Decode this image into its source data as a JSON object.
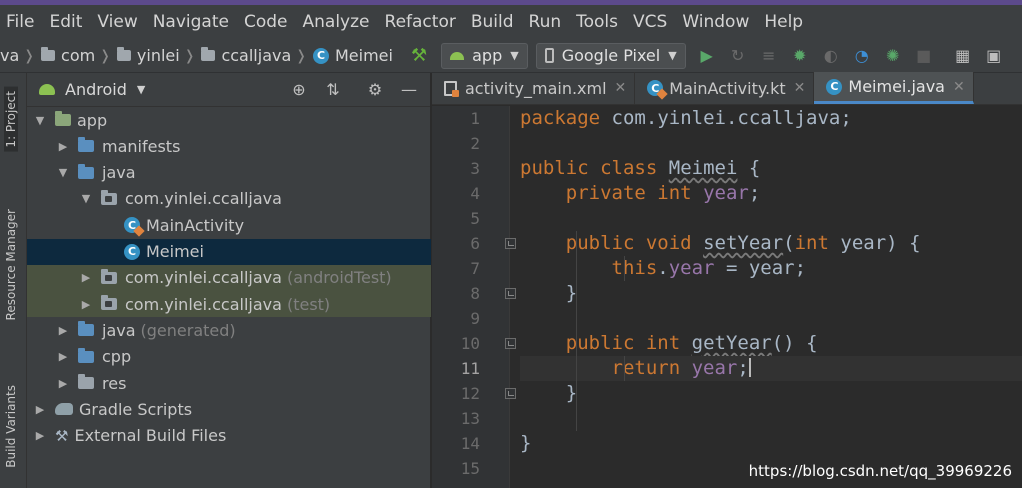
{
  "menu": [
    "File",
    "Edit",
    "View",
    "Navigate",
    "Code",
    "Analyze",
    "Refactor",
    "Build",
    "Run",
    "Tools",
    "VCS",
    "Window",
    "Help"
  ],
  "breadcrumb": {
    "items": [
      "va",
      "com",
      "yinlei",
      "ccalljava"
    ],
    "file": "Meimei"
  },
  "toolbar": {
    "config": "app",
    "device": "Google Pixel",
    "icons": [
      "build-hammer-icon",
      "run-icon",
      "apply-changes-icon",
      "apply-code-changes-icon",
      "debug-icon",
      "attach-debugger-icon",
      "profile-icon",
      "sync-icon",
      "stop-icon",
      "project-structure-icon",
      "sdk-manager-icon"
    ]
  },
  "left_strip": {
    "project": "1: Project",
    "resource_manager": "Resource Manager",
    "build_variants": "Build Variants"
  },
  "project_panel": {
    "view": "Android",
    "tree": [
      {
        "label": "app",
        "suffix": "",
        "indent": 0,
        "expanded": true,
        "icon": "app-folder-icon"
      },
      {
        "label": "manifests",
        "suffix": "",
        "indent": 1,
        "expanded": false,
        "icon": "folder-icon"
      },
      {
        "label": "java",
        "suffix": "",
        "indent": 1,
        "expanded": true,
        "icon": "folder-icon"
      },
      {
        "label": "com.yinlei.ccalljava",
        "suffix": "",
        "indent": 2,
        "expanded": true,
        "icon": "package-icon"
      },
      {
        "label": "MainActivity",
        "suffix": "",
        "indent": 3,
        "expanded": null,
        "icon": "kotlin-class-icon"
      },
      {
        "label": "Meimei",
        "suffix": "",
        "indent": 3,
        "expanded": null,
        "icon": "java-class-icon",
        "selected": true
      },
      {
        "label": "com.yinlei.ccalljava",
        "suffix": "(androidTest)",
        "indent": 2,
        "expanded": false,
        "icon": "package-icon",
        "tinted": true
      },
      {
        "label": "com.yinlei.ccalljava",
        "suffix": "(test)",
        "indent": 2,
        "expanded": false,
        "icon": "package-icon",
        "tinted": true
      },
      {
        "label": "java",
        "suffix": "(generated)",
        "indent": 1,
        "expanded": false,
        "icon": "generated-folder-icon"
      },
      {
        "label": "cpp",
        "suffix": "",
        "indent": 1,
        "expanded": false,
        "icon": "folder-icon"
      },
      {
        "label": "res",
        "suffix": "",
        "indent": 1,
        "expanded": false,
        "icon": "res-folder-icon"
      },
      {
        "label": "Gradle Scripts",
        "suffix": "",
        "indent": 0,
        "expanded": false,
        "icon": "gradle-icon"
      },
      {
        "label": "External Build Files",
        "suffix": "",
        "indent": 0,
        "expanded": false,
        "icon": "wrench-icon"
      }
    ]
  },
  "editor": {
    "tabs": [
      {
        "label": "activity_main.xml",
        "active": false,
        "icon": "xml-file-icon"
      },
      {
        "label": "MainActivity.kt",
        "active": false,
        "icon": "kotlin-class-icon"
      },
      {
        "label": "Meimei.java",
        "active": true,
        "icon": "java-class-icon"
      }
    ],
    "current_line": 11,
    "lines": [
      "package com.yinlei.ccalljava;",
      "",
      "public class Meimei {",
      "    private int year;",
      "",
      "    public void setYear(int year) {",
      "        this.year = year;",
      "    }",
      "",
      "    public int getYear() {",
      "        return year;",
      "    }",
      "",
      "}",
      ""
    ]
  },
  "watermark": "https://blog.csdn.net/qq_39969226",
  "colors": {
    "keyword": "#cc7832",
    "field": "#9876aa",
    "plain": "#a9b7c6",
    "selection": "#0d293e",
    "tab_underline": "#4a88c7"
  }
}
